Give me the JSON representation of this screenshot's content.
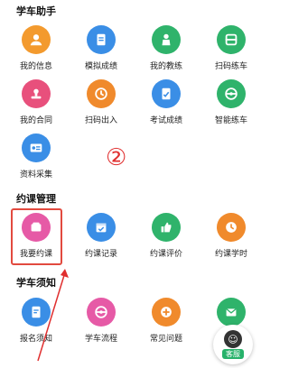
{
  "sections": {
    "assistant": {
      "title": "学车助手"
    },
    "booking": {
      "title": "约课管理"
    },
    "notice": {
      "title": "学车须知"
    }
  },
  "assistant_items": [
    {
      "label": "我的信息",
      "icon": "user-info-icon",
      "color": "#f39a2e"
    },
    {
      "label": "模拟成绩",
      "icon": "document-icon",
      "color": "#3a8ee6"
    },
    {
      "label": "我的教练",
      "icon": "coach-icon",
      "color": "#2fb36b"
    },
    {
      "label": "扫码练车",
      "icon": "scan-icon",
      "color": "#2fb36b"
    },
    {
      "label": "我的合同",
      "icon": "contract-stamp-icon",
      "color": "#e8507c"
    },
    {
      "label": "扫码出入",
      "icon": "clock-scan-icon",
      "color": "#f08a2c"
    },
    {
      "label": "考试成绩",
      "icon": "exam-score-icon",
      "color": "#3a8ee6"
    },
    {
      "label": "智能练车",
      "icon": "steering-wheel-icon",
      "color": "#2fb36b"
    },
    {
      "label": "资料采集",
      "icon": "id-card-icon",
      "color": "#3a8ee6"
    }
  ],
  "booking_items": [
    {
      "label": "我要约课",
      "icon": "book-class-icon",
      "color": "#e65aa6"
    },
    {
      "label": "约课记录",
      "icon": "calendar-record-icon",
      "color": "#3a8ee6"
    },
    {
      "label": "约课评价",
      "icon": "thumbs-up-icon",
      "color": "#2fb36b"
    },
    {
      "label": "约课学时",
      "icon": "clock-hours-icon",
      "color": "#f08a2c"
    }
  ],
  "notice_items": [
    {
      "label": "报名须知",
      "icon": "registration-note-icon",
      "color": "#3a8ee6"
    },
    {
      "label": "学车流程",
      "icon": "process-steering-icon",
      "color": "#e65aa6"
    },
    {
      "label": "常见问题",
      "icon": "faq-plus-icon",
      "color": "#f08a2c"
    },
    {
      "label": "",
      "icon": "mail-icon",
      "color": "#2fb36b"
    }
  ],
  "step_marker": "②",
  "customer_service": {
    "label": "客服",
    "icon": "customer-service-icon"
  },
  "accent": {
    "highlight": "#e24a3f",
    "arrow": "#e02f2f"
  }
}
